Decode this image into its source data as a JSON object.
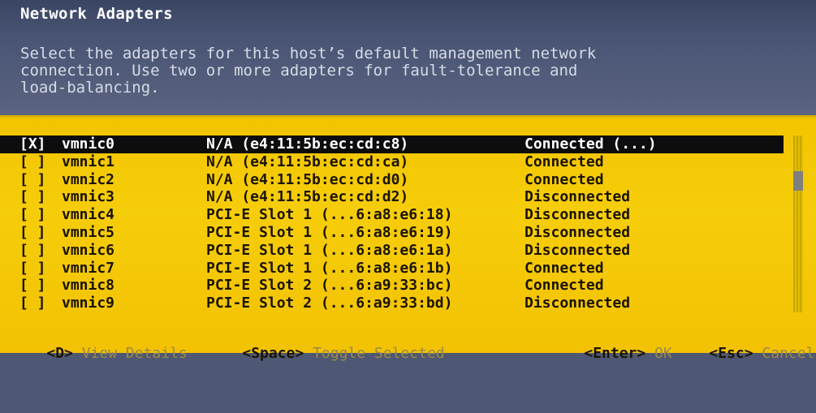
{
  "dialog": {
    "title": "Network Adapters",
    "description": "Select the adapters for this host’s default management network\nconnection. Use two or more adapters for fault-tolerance and\nload-balancing."
  },
  "adapters": [
    {
      "check": "[X]",
      "name": "vmnic0",
      "device": "N/A (e4:11:5b:ec:cd:c8)",
      "status": "Connected (...)",
      "selected": true
    },
    {
      "check": "[ ]",
      "name": "vmnic1",
      "device": "N/A (e4:11:5b:ec:cd:ca)",
      "status": "Connected",
      "selected": false
    },
    {
      "check": "[ ]",
      "name": "vmnic2",
      "device": "N/A (e4:11:5b:ec:cd:d0)",
      "status": "Connected",
      "selected": false
    },
    {
      "check": "[ ]",
      "name": "vmnic3",
      "device": "N/A (e4:11:5b:ec:cd:d2)",
      "status": "Disconnected",
      "selected": false
    },
    {
      "check": "[ ]",
      "name": "vmnic4",
      "device": "PCI-E Slot 1 (...6:a8:e6:18)",
      "status": "Disconnected",
      "selected": false
    },
    {
      "check": "[ ]",
      "name": "vmnic5",
      "device": "PCI-E Slot 1 (...6:a8:e6:19)",
      "status": "Disconnected",
      "selected": false
    },
    {
      "check": "[ ]",
      "name": "vmnic6",
      "device": "PCI-E Slot 1 (...6:a8:e6:1a)",
      "status": "Disconnected",
      "selected": false
    },
    {
      "check": "[ ]",
      "name": "vmnic7",
      "device": "PCI-E Slot 1 (...6:a8:e6:1b)",
      "status": "Connected",
      "selected": false
    },
    {
      "check": "[ ]",
      "name": "vmnic8",
      "device": "PCI-E Slot 2 (...6:a9:33:bc)",
      "status": "Connected",
      "selected": false
    },
    {
      "check": "[ ]",
      "name": "vmnic9",
      "device": "PCI-E Slot 2 (...6:a9:33:bd)",
      "status": "Disconnected",
      "selected": false
    }
  ],
  "footer": {
    "view_details_key": "<D>",
    "view_details_label": "View Details",
    "toggle_key": "<Space>",
    "toggle_label": "Toggle Selected",
    "ok_key": "<Enter>",
    "ok_label": "OK",
    "cancel_key": "<Esc>",
    "cancel_label": "Cancel"
  },
  "colors": {
    "header_bg": "#4e5874",
    "panel_bg": "#f2c400",
    "selected_row_bg": "#0d0d0d"
  }
}
